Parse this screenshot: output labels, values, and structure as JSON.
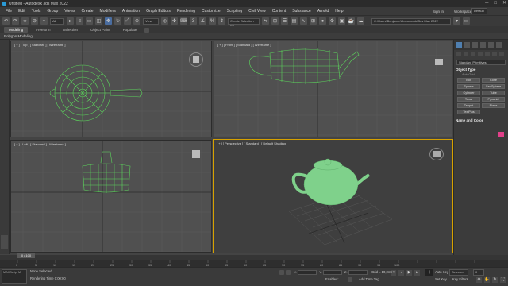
{
  "window": {
    "title": "Untitled - Autodesk 3ds Max 2022",
    "controls": [
      "─",
      "□",
      "✕"
    ]
  },
  "menu": [
    "File",
    "Edit",
    "Tools",
    "Group",
    "Views",
    "Create",
    "Modifiers",
    "Animation",
    "Graph Editors",
    "Rendering",
    "Customize",
    "Scripting",
    "Civil View",
    "Content",
    "Substance",
    "Arnold",
    "Help"
  ],
  "account": {
    "signin": "Sign In",
    "workspaces_label": "Workspaces:",
    "workspace": "Default"
  },
  "toolbar": {
    "view_select": "View",
    "selection_set": "Create Selection Se",
    "path": "C:\\Users\\Benjamin\\Documents\\3ds Max 2022"
  },
  "ribbon": {
    "tabs": [
      "Modeling",
      "Freeform",
      "Selection",
      "Object Paint",
      "Populate"
    ],
    "active": "Modeling",
    "sub": "Polygon Modeling"
  },
  "viewports": {
    "top": "[ + ] [ Top ] [ Standard ] [ Wireframe ]",
    "front": "[ + ] [ Front ] [ Standard ] [ Wireframe ]",
    "left": "[ + ] [ Left ] [ Standard ] [ Wireframe ]",
    "perspective": "[ + ] [ Perspective ] [ Standard ] [ Default Shading ]"
  },
  "command_panel": {
    "category": "Standard Primitives",
    "rollout_object_type": "Object Type",
    "autogrid": "AutoGrid",
    "buttons": [
      "Box",
      "Cone",
      "Sphere",
      "GeoSphere",
      "Cylinder",
      "Tube",
      "Torus",
      "Pyramid",
      "Teapot",
      "Plane",
      "TextPlus"
    ],
    "rollout_name": "Name and Color",
    "swatch_color": "#e2408a"
  },
  "timeline": {
    "frames": "0 / 100",
    "ticks": [
      "0",
      "5",
      "10",
      "15",
      "20",
      "25",
      "30",
      "35",
      "40",
      "45",
      "50",
      "55",
      "60",
      "65",
      "70",
      "75",
      "80",
      "85",
      "90",
      "95",
      "100"
    ]
  },
  "status": {
    "maxscript": "MAXScript Mi",
    "selected": "None Selected",
    "prompt": "Rendering Time 0:00:00",
    "x_label": "X:",
    "y_label": "Y:",
    "z_label": "Z:",
    "grid": "Grid = 10,0mm",
    "enabled": "Enabled:",
    "add_time_tag": "Add Time Tag",
    "auto_key": "Auto Key",
    "set_key": "Set Key",
    "key_filters": "Key Filters...",
    "selected_set": "Selected",
    "frame": "0"
  },
  "colors": {
    "wire": "#5cd65c",
    "teapot": "#7fd18b",
    "active_border": "#d6a100"
  }
}
